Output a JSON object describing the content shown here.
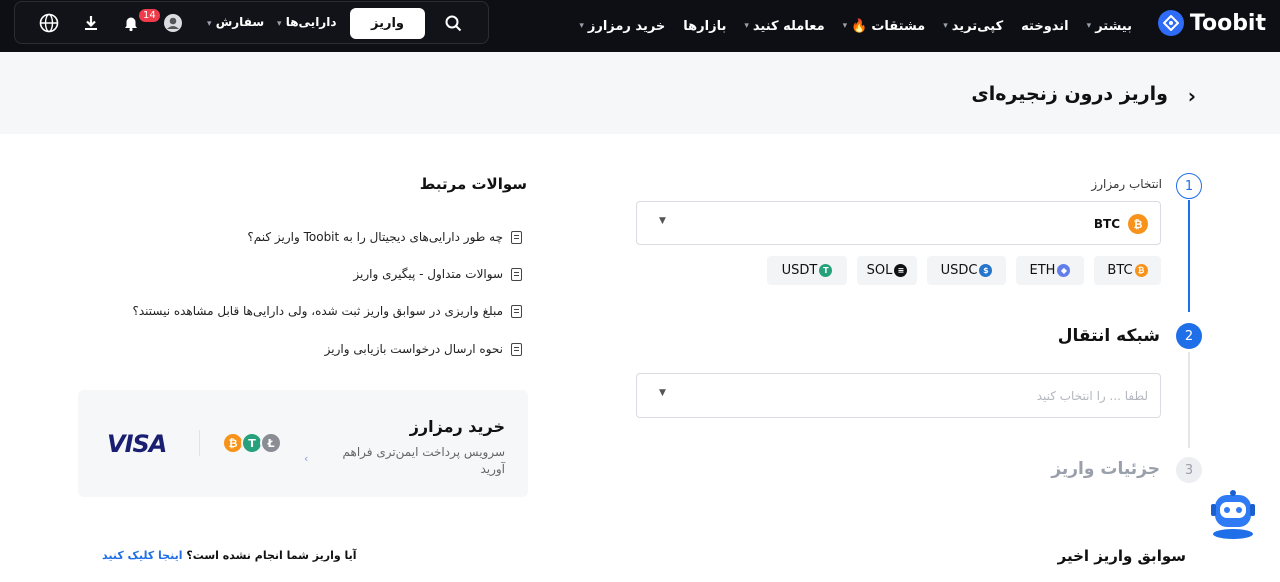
{
  "brand": {
    "name": "Toobit"
  },
  "nav": {
    "items": [
      {
        "label": "خرید رمزارز",
        "caret": true
      },
      {
        "label": "بازارها",
        "caret": false
      },
      {
        "label": "معامله کنید",
        "caret": true
      },
      {
        "label": "مشتقات",
        "caret": true,
        "fire": true
      },
      {
        "label": "کپی‌ترید",
        "caret": true
      },
      {
        "label": "اندوخته",
        "caret": false
      },
      {
        "label": "بیشتر",
        "caret": true
      }
    ]
  },
  "toolbar": {
    "deposit_label": "واریز",
    "assets_label": "دارایی‌ها",
    "orders_label": "سفارش",
    "notification_count": "14"
  },
  "page": {
    "title": "واریز درون زنجیره‌ای"
  },
  "steps": {
    "step1": {
      "number": "1",
      "label": "انتخاب رمزارز"
    },
    "step2": {
      "number": "2",
      "title": "شبکه انتقال"
    },
    "step3": {
      "number": "3",
      "title": "جزئیات واریز"
    }
  },
  "coin_select": {
    "value": "BTC"
  },
  "coin_chips": [
    {
      "label": "BTC",
      "color": "#f7931a",
      "glyph": "₿"
    },
    {
      "label": "ETH",
      "color": "#627eea",
      "glyph": "◆"
    },
    {
      "label": "USDC",
      "color": "#2775ca",
      "glyph": "$"
    },
    {
      "label": "SOL",
      "color": "#111111",
      "glyph": "≡"
    },
    {
      "label": "USDT",
      "color": "#26a17b",
      "glyph": "T"
    }
  ],
  "network_select": {
    "placeholder": "لطفا ... را انتخاب کنید"
  },
  "recent_deposits": {
    "title": "سوابق واریز اخیر"
  },
  "faq": {
    "title": "سوالات مرتبط",
    "items": [
      "چه طور دارایی‌های دیجیتال را به Toobit واریز کنم؟",
      "سوالات متداول - پیگیری واریز",
      "مبلغ واریزی در سوابق واریز ثبت شده، ولی دارایی‌ها قابل مشاهده نیستند؟",
      "نحوه ارسال درخواست بازیابی واریز"
    ]
  },
  "buy_card": {
    "title": "خرید رمزارز",
    "description": "سرویس پرداخت ایمن‌تری فراهم آورید",
    "payment_brand": "VISA"
  },
  "bottom_note": {
    "question": "آیا واریز شما انجام نشده است؟ ",
    "link": "اینجا کلیک کنید"
  },
  "colors": {
    "accent": "#1f6fe8",
    "topbar": "#0e0f14"
  }
}
